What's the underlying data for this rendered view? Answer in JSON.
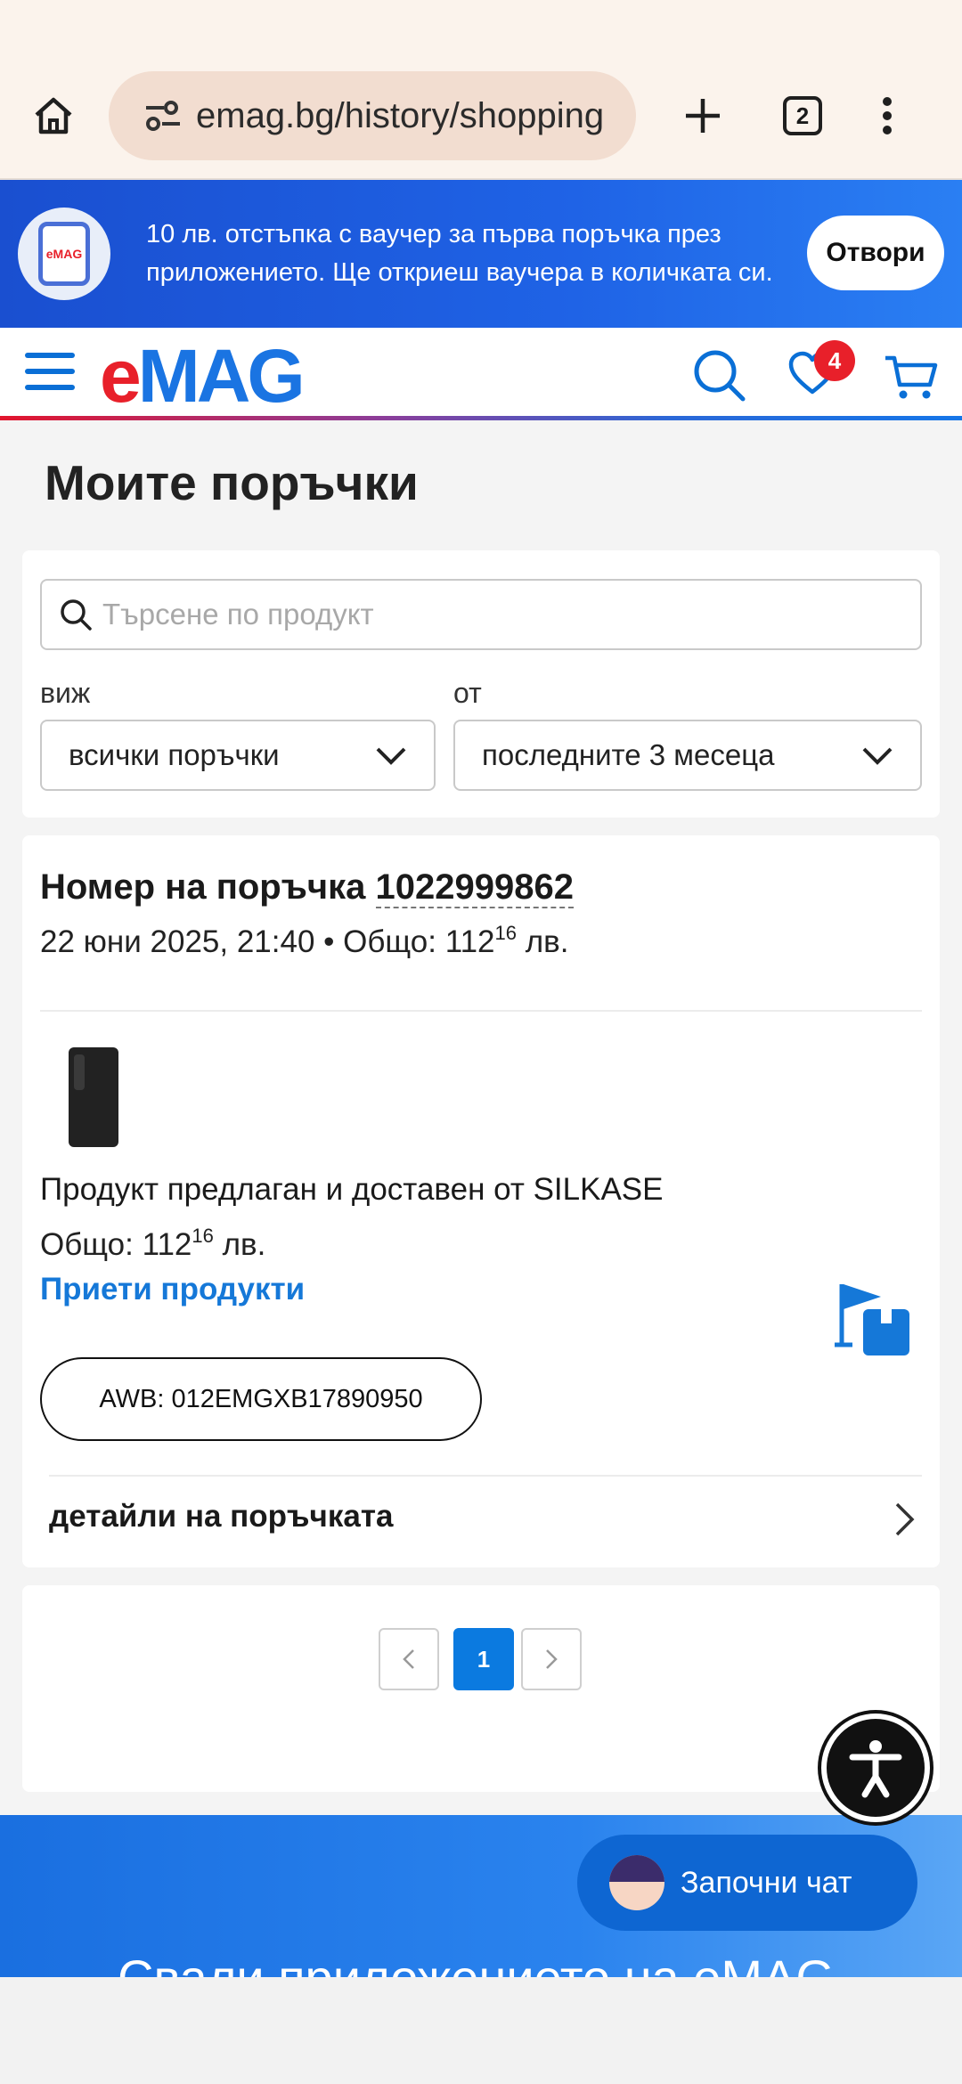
{
  "browser": {
    "url": "emag.bg/history/shopping",
    "tab_count": "2"
  },
  "app_banner": {
    "text": "10 лв. отстъпка с ваучер за първа поръчка през приложението. Ще откриеш ваучера в количката си.",
    "open_label": "Отвори"
  },
  "header": {
    "logo_e": "e",
    "logo_mag": "MAG",
    "favorites_count": "4",
    "accent_color": "#1a74e2",
    "brand_red": "#e8202a"
  },
  "page": {
    "title": "Моите поръчки"
  },
  "filters": {
    "search_placeholder": "Търсене по продукт",
    "view_label": "виж",
    "view_value": "всички поръчки",
    "from_label": "от",
    "from_value": "последните 3 месеца"
  },
  "order": {
    "title_prefix": "Номер на поръчка",
    "number": "1022999862",
    "date": "22 юни 2025, 21:40",
    "meta_sep": " • Общо: ",
    "total_int": "112",
    "total_dec": "16",
    "currency": " лв.",
    "seller": "Продукт предлаган и доставен от SILKASE",
    "subtotal_label": "Общо: ",
    "status": "Приети продукти",
    "awb": "AWB: 012EMGXB17890950",
    "details_label": "детайли на поръчката"
  },
  "pagination": {
    "current": "1"
  },
  "footer": {
    "chat_label": "Започни чат",
    "partial_text": "Свали приложението на eMAG"
  }
}
